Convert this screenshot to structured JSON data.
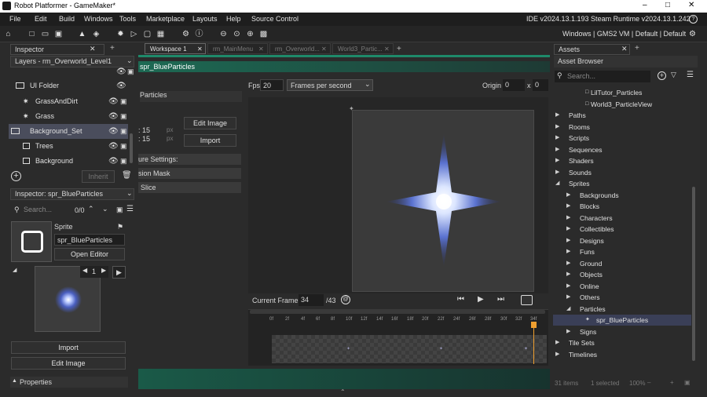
{
  "window": {
    "title": "Robot Platformer - GameMaker*"
  },
  "menu": {
    "items": [
      "File",
      "Edit",
      "Build",
      "Windows",
      "Tools",
      "Marketplace",
      "Layouts",
      "Help",
      "Source Control"
    ],
    "ide_info": "IDE v2024.13.1.193 Steam  Runtime v2024.13.1.242"
  },
  "toolbar": {
    "targets": "Windows | GMS2 VM | Default | Default"
  },
  "inspector": {
    "title": "Inspector",
    "layers_header": "Layers - rm_Overworld_Level1",
    "layers": [
      {
        "label": "UI Folder"
      },
      {
        "label": "GrassAndDirt"
      },
      {
        "label": "Grass"
      },
      {
        "label": "Background_Set"
      },
      {
        "label": "Trees"
      },
      {
        "label": "Background"
      }
    ],
    "inherit_label": "Inherit"
  },
  "inspector2": {
    "title": "Inspector: spr_BlueParticles",
    "search_placeholder": "Search...",
    "counter": "0/0",
    "sprite_label": "Sprite",
    "sprite_name": "spr_BlueParticles",
    "open_editor": "Open Editor",
    "frame_number": "1",
    "import_label": "Import",
    "edit_image_label": "Edit Image",
    "properties_label": "Properties"
  },
  "workspace": {
    "tabs": [
      "Workspace 1",
      "rm_MainMenu",
      "rm_Overworld...",
      "World3_Partic..."
    ],
    "sprite_header": "spr_BlueParticles",
    "panel_title": "Particles",
    "w_label": ": 15",
    "h_label": ": 15",
    "px1": "px",
    "px2": "px",
    "edit_image": "Edit Image",
    "import": "Import",
    "texture_settings": "ure Settings:",
    "collision_mask": "sion Mask",
    "nine_slice": "Slice"
  },
  "editor": {
    "fps_label": "Fps",
    "fps_value": "20",
    "fps_mode": "Frames per second",
    "origin_label": "Origin",
    "origin_x": "0",
    "origin_sep": "x",
    "origin_y": "0",
    "current_frame_label": "Current Frame:",
    "current_frame": "34",
    "frame_total": "/43",
    "ticks": [
      "0f",
      "2f",
      "4f",
      "6f",
      "8f",
      "10f",
      "12f",
      "14f",
      "16f",
      "18f",
      "20f",
      "22f",
      "24f",
      "26f",
      "28f",
      "30f",
      "32f",
      "34f"
    ]
  },
  "assets": {
    "tab_title": "Assets",
    "browser_title": "Asset Browser",
    "search_placeholder": "Search...",
    "items": [
      {
        "label": "LilTutor_Particles",
        "level": 2,
        "type": "file"
      },
      {
        "label": "World3_ParticleView",
        "level": 2,
        "type": "file"
      },
      {
        "label": "Paths",
        "level": 0,
        "type": "folder"
      },
      {
        "label": "Rooms",
        "level": 0,
        "type": "folder"
      },
      {
        "label": "Scripts",
        "level": 0,
        "type": "folder"
      },
      {
        "label": "Sequences",
        "level": 0,
        "type": "folder"
      },
      {
        "label": "Shaders",
        "level": 0,
        "type": "folder"
      },
      {
        "label": "Sounds",
        "level": 0,
        "type": "folder"
      },
      {
        "label": "Sprites",
        "level": 0,
        "type": "open"
      },
      {
        "label": "Backgrounds",
        "level": 1,
        "type": "folder"
      },
      {
        "label": "Blocks",
        "level": 1,
        "type": "folder"
      },
      {
        "label": "Characters",
        "level": 1,
        "type": "folder"
      },
      {
        "label": "Collectibles",
        "level": 1,
        "type": "folder"
      },
      {
        "label": "Designs",
        "level": 1,
        "type": "folder"
      },
      {
        "label": "Funs",
        "level": 1,
        "type": "folder"
      },
      {
        "label": "Ground",
        "level": 1,
        "type": "folder"
      },
      {
        "label": "Objects",
        "level": 1,
        "type": "folder"
      },
      {
        "label": "Online",
        "level": 1,
        "type": "folder"
      },
      {
        "label": "Others",
        "level": 1,
        "type": "folder"
      },
      {
        "label": "Particles",
        "level": 1,
        "type": "open"
      },
      {
        "label": "spr_BlueParticles",
        "level": 2,
        "type": "sprite"
      },
      {
        "label": "Signs",
        "level": 1,
        "type": "folder"
      },
      {
        "label": "Tile Sets",
        "level": 0,
        "type": "folder"
      },
      {
        "label": "Timelines",
        "level": 0,
        "type": "folder"
      }
    ],
    "status_items": "31 items",
    "status_selected": "1 selected",
    "zoom": "100%"
  },
  "colors": {
    "accent": "#1a7a5e",
    "teal": "#1e8a6a",
    "selection": "#3a3f57",
    "playhead": "#f0a030"
  }
}
